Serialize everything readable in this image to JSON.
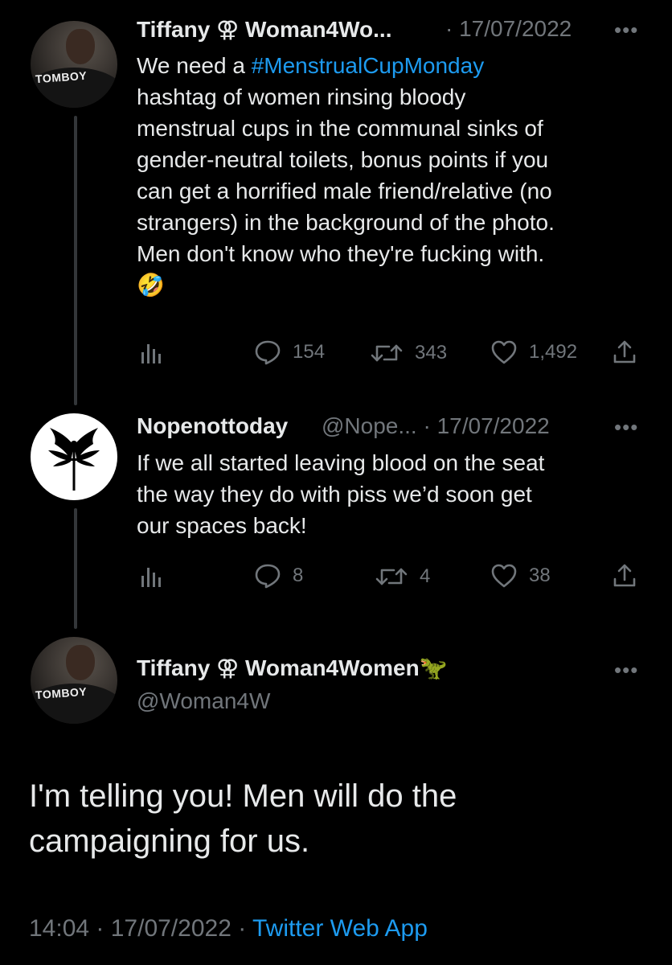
{
  "tweet1": {
    "display_name": "Tiffany ⚢ Woman4Wo...",
    "meta": "· 17/07/2022",
    "more_label": "•••",
    "avatar_text": "TOMBOY",
    "text_prefix": "We need a ",
    "hashtag": "#MenstrualCupMonday",
    "lines": [
      "hashtag of women rinsing bloody",
      "menstrual cups in the communal sinks of",
      "gender-neutral toilets, bonus points if you",
      "can get a horrified male friend/relative (no",
      "strangers) in the background of the photo.",
      "Men don't know who they're fucking with.",
      "🤣"
    ],
    "replies": "154",
    "retweets": "343",
    "likes": "1,492"
  },
  "tweet2": {
    "display_name": "Nopenottoday",
    "meta": "@Nope... · 17/07/2022",
    "more_label": "•••",
    "lines": [
      "If we all started leaving blood on the seat",
      "the way they do with piss we’d soon get",
      "our spaces back!"
    ],
    "replies": "8",
    "retweets": "4",
    "likes": "38"
  },
  "main_tweet": {
    "display_name": "Tiffany ⚢ Woman4Women🦖",
    "handle": "@Woman4W",
    "more_label": "•••",
    "avatar_text": "TOMBOY",
    "lines": [
      "I'm telling you! Men will do the",
      "campaigning for us."
    ],
    "time_date": "14:04 · 17/07/2022 · ",
    "source_app": "Twitter Web App"
  },
  "colors": {
    "background": "#000000",
    "text_primary": "#e7e9ea",
    "text_secondary": "#71767b",
    "accent": "#1d9bf0"
  },
  "icons": [
    "reply-icon",
    "retweet-icon",
    "like-icon",
    "share-icon",
    "analytics-icon",
    "more-icon"
  ]
}
